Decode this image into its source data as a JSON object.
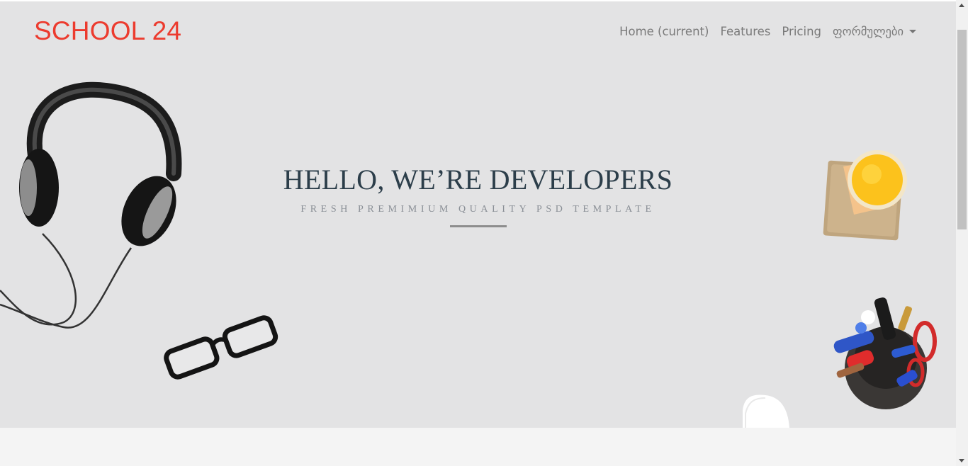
{
  "header": {
    "brand": "SCHOOL 24",
    "nav": [
      {
        "label": "Home (current)"
      },
      {
        "label": "Features"
      },
      {
        "label": "Pricing"
      },
      {
        "label": "ფორმულები"
      }
    ]
  },
  "hero": {
    "headline": "HELLO, WE’RE DEVELOPERS",
    "subline": "FRESH PREMIMIUM QUALITY PSD TEMPLATE"
  },
  "decorations": [
    "headphones-icon",
    "glasses-icon",
    "juice-glass-icon",
    "pen-holder-icon",
    "mouse-icon"
  ],
  "colors": {
    "brand": "#ec3b2e",
    "hero_bg": "#e3e3e4",
    "headline": "#2c3e4a"
  }
}
